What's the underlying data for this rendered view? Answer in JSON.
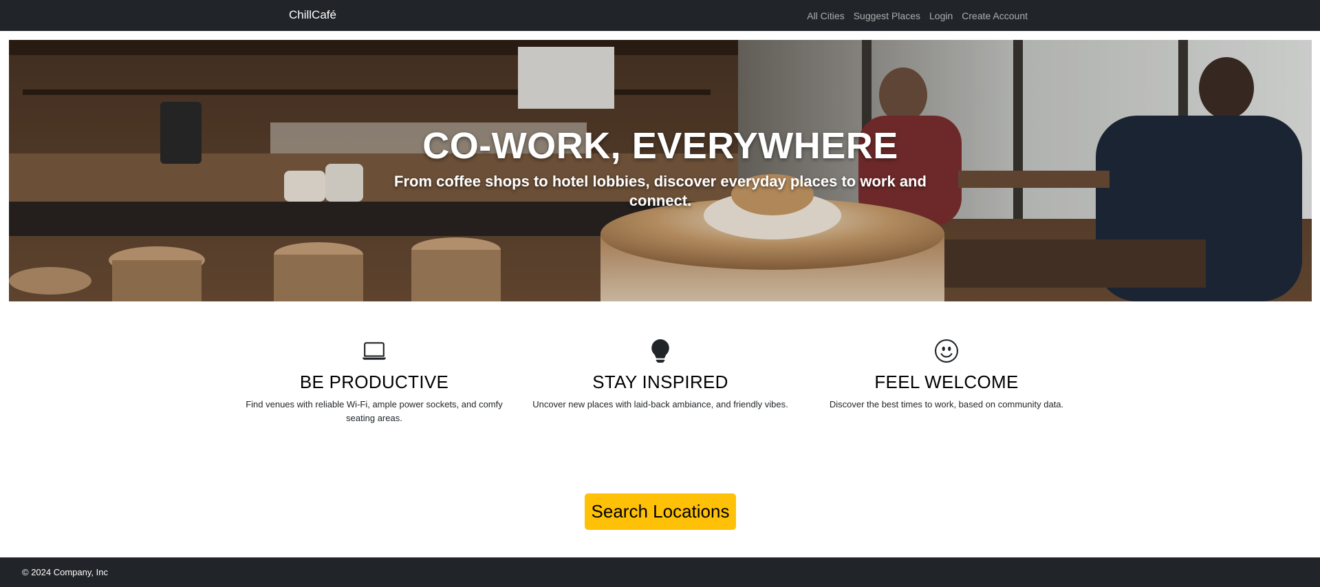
{
  "navbar": {
    "brand": "ChillCafé",
    "links": [
      "All Cities",
      "Suggest Places",
      "Login",
      "Create Account"
    ]
  },
  "hero": {
    "title": "CO-WORK, EVERYWHERE",
    "subtitle": "From coffee shops to hotel lobbies, discover everyday places to work and connect."
  },
  "features": [
    {
      "icon": "laptop-icon",
      "title": "BE PRODUCTIVE",
      "text": "Find venues with reliable Wi-Fi, ample power sockets, and comfy seating areas."
    },
    {
      "icon": "lightbulb-icon",
      "title": "STAY INSPIRED",
      "text": "Uncover new places with laid-back ambiance, and friendly vibes."
    },
    {
      "icon": "smiley-icon",
      "title": "FEEL WELCOME",
      "text": "Discover the best times to work, based on community data."
    }
  ],
  "cta": {
    "label": "Search Locations"
  },
  "footer": {
    "copyright": "© 2024 Company, Inc"
  },
  "colors": {
    "navbar_bg": "#212529",
    "cta_bg": "#ffc107",
    "footer_bg": "#212529"
  }
}
